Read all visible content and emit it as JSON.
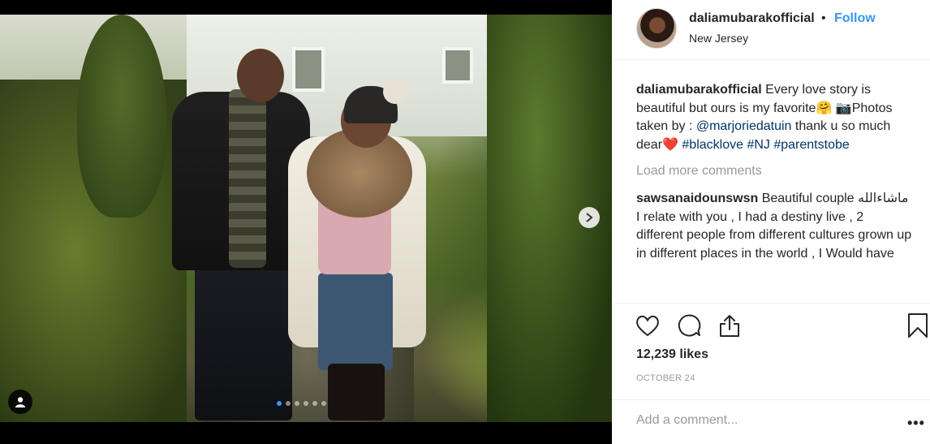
{
  "post": {
    "dots_count": 6,
    "active_dot": 0
  },
  "header": {
    "username": "daliamubarakofficial",
    "separator": "•",
    "follow_label": "Follow",
    "location": "New Jersey"
  },
  "caption": {
    "username": "daliamubarakofficial",
    "text_1": " Every love story is beautiful but ours is my favorite🤗 📷Photos taken by : ",
    "mention": "@marjoriedatuin",
    "text_2": " thank u so much dear❤️ ",
    "tag_1": "#blacklove",
    "tag_2": "#NJ",
    "tag_3": "#parentstobe"
  },
  "load_more": "Load more comments",
  "comment": {
    "username": "sawsanaidounswsn",
    "text": " Beautiful couple ماشاءالله I relate with you , I had a destiny live , 2 different people from different cultures grown up in different places in the world , I Would have"
  },
  "actions": {
    "like_icon": "heart-icon",
    "comment_icon": "comment-icon",
    "share_icon": "share-icon",
    "save_icon": "bookmark-icon"
  },
  "likes": "12,239 likes",
  "date": "OCTOBER 24",
  "add_comment": {
    "placeholder": "Add a comment...",
    "more_options": "•••"
  }
}
